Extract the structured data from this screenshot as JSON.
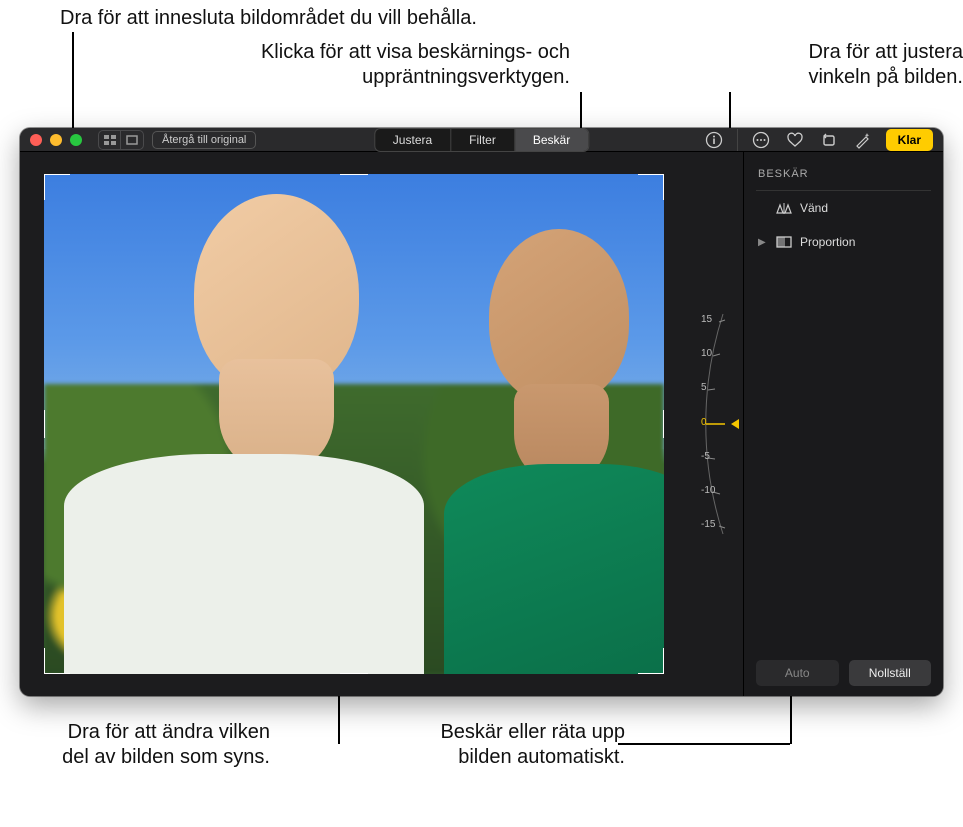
{
  "callouts": {
    "dragEnclose": "Dra för att innesluta bildområdet du vill behålla.",
    "clickShowTools1": "Klicka för att visa beskärnings- och",
    "clickShowTools2": "uppräntningsverktygen.",
    "dragAngle1": "Dra för att justera",
    "dragAngle2": "vinkeln på bilden.",
    "dragChange1": "Dra för att ändra vilken",
    "dragChange2": "del av bilden som syns.",
    "autoCrop1": "Beskär eller räta upp",
    "autoCrop2": "bilden automatiskt."
  },
  "toolbar": {
    "revert": "Återgå till original",
    "segments": {
      "adjust": "Justera",
      "filter": "Filter",
      "crop": "Beskär"
    },
    "done": "Klar"
  },
  "angle": {
    "t15": "15",
    "t10": "10",
    "t5": "5",
    "zero": "0",
    "b5": "-5",
    "b10": "-10",
    "b15": "-15"
  },
  "side": {
    "title": "BESKÄR",
    "flip": "Vänd",
    "aspect": "Proportion",
    "auto": "Auto",
    "reset": "Nollställ"
  }
}
